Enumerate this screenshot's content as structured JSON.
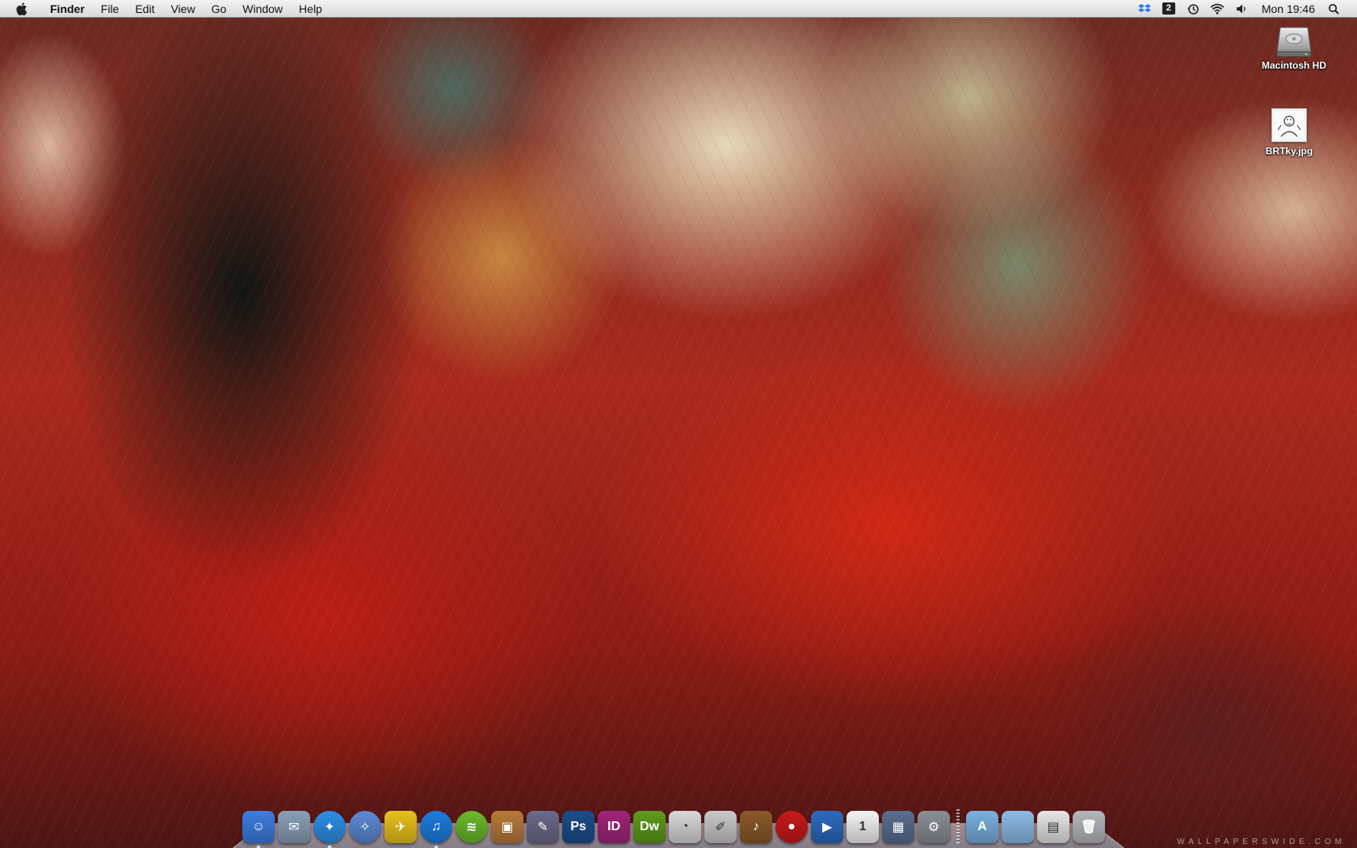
{
  "menubar": {
    "apple_icon": "apple-logo-icon",
    "app_name": "Finder",
    "menus": [
      "File",
      "Edit",
      "View",
      "Go",
      "Window",
      "Help"
    ],
    "status_icons": [
      "dropbox-icon",
      "spaces-icon",
      "time-machine-icon",
      "wifi-icon",
      "volume-icon"
    ],
    "spaces_number": "2",
    "clock": "Mon 19:46",
    "search_icon": "spotlight-icon"
  },
  "desktop_icons": [
    {
      "label": "Macintosh HD",
      "icon": "hard-drive-icon"
    },
    {
      "label": "BRTky.jpg",
      "icon": "image-file-icon"
    }
  ],
  "dock": {
    "apps": [
      {
        "icon": "finder-icon",
        "glyph": "☺",
        "color": "#3d7ee0",
        "running": true
      },
      {
        "icon": "mail-icon",
        "glyph": "✉",
        "color": "#8aa0b8",
        "running": false
      },
      {
        "icon": "safari-icon",
        "glyph": "✦",
        "color": "#2d8fe6",
        "running": true
      },
      {
        "icon": "network-utility-icon",
        "glyph": "✧",
        "color": "#5c8ad6",
        "running": false
      },
      {
        "icon": "twitter-bird-icon",
        "glyph": "✈",
        "color": "#e8c21a",
        "running": false
      },
      {
        "icon": "itunes-icon",
        "glyph": "♫",
        "color": "#1d7de0",
        "running": true
      },
      {
        "icon": "spotify-icon",
        "glyph": "≋",
        "color": "#6cb82a",
        "running": false
      },
      {
        "icon": "iphoto-icon",
        "glyph": "▣",
        "color": "#b87a3a",
        "running": false
      },
      {
        "icon": "script-editor-icon",
        "glyph": "✎",
        "color": "#6a6a8a",
        "running": false
      },
      {
        "icon": "photoshop-icon",
        "glyph": "Ps",
        "color": "#1c4d8c",
        "running": false
      },
      {
        "icon": "indesign-icon",
        "glyph": "ID",
        "color": "#a2257a",
        "running": false
      },
      {
        "icon": "dreamweaver-icon",
        "glyph": "Dw",
        "color": "#5f9a1c",
        "running": false
      },
      {
        "icon": "color-picker-icon",
        "glyph": "◔",
        "color": "#d8d8d8",
        "running": false
      },
      {
        "icon": "textedit-icon",
        "glyph": "✐",
        "color": "#c9c9c9",
        "running": false
      },
      {
        "icon": "garageband-icon",
        "glyph": "♪",
        "color": "#8a5a2a",
        "running": false
      },
      {
        "icon": "record-button-icon",
        "glyph": "●",
        "color": "#c81a1a",
        "running": false
      },
      {
        "icon": "imovie-icon",
        "glyph": "▶",
        "color": "#2c6ac0",
        "running": false
      },
      {
        "icon": "ical-icon",
        "glyph": "1",
        "color": "#f4f4f4",
        "running": false
      },
      {
        "icon": "dashboard-icon",
        "glyph": "▦",
        "color": "#5a6e8e",
        "running": false
      },
      {
        "icon": "system-preferences-icon",
        "glyph": "⚙",
        "color": "#8a8f96",
        "running": false
      }
    ],
    "folders": [
      {
        "icon": "applications-folder-icon",
        "glyph": "A",
        "color": "#7ab0e0"
      },
      {
        "icon": "documents-folder-icon",
        "glyph": "",
        "color": "#8cbbe6"
      },
      {
        "icon": "downloads-stack-icon",
        "glyph": "▤",
        "color": "#e6e6e6"
      },
      {
        "icon": "trash-icon",
        "glyph": "🗑",
        "color": "#b4b8bd"
      }
    ]
  },
  "watermark": "WALLPAPERSWIDE.COM"
}
